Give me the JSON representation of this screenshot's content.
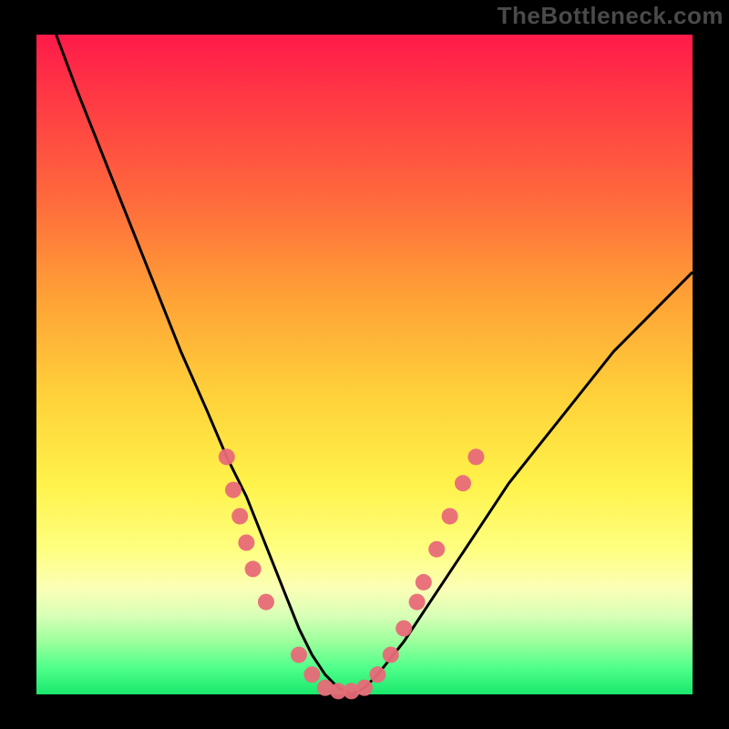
{
  "watermark": "TheBottleneck.com",
  "colors": {
    "frame_bg": "#000000",
    "dot": "#e86a78",
    "curve": "#000000"
  },
  "chart_data": {
    "type": "line",
    "title": "",
    "xlabel": "",
    "ylabel": "",
    "xlim": [
      0,
      100
    ],
    "ylim": [
      0,
      100
    ],
    "grid": false,
    "series": [
      {
        "name": "bottleneck-curve",
        "x": [
          3,
          6,
          10,
          14,
          18,
          22,
          26,
          29,
          32,
          34,
          36,
          38,
          40,
          42,
          44,
          46,
          48,
          50,
          52,
          56,
          60,
          64,
          68,
          72,
          76,
          80,
          84,
          88,
          92,
          96,
          100
        ],
        "y": [
          100,
          92,
          82,
          72,
          62,
          52,
          43,
          36,
          30,
          25,
          20,
          15,
          10,
          6,
          3,
          1,
          0,
          1,
          3,
          8,
          14,
          20,
          26,
          32,
          37,
          42,
          47,
          52,
          56,
          60,
          64
        ]
      }
    ],
    "scatter": [
      {
        "name": "left-marks",
        "points": [
          {
            "x": 29,
            "y": 36
          },
          {
            "x": 30,
            "y": 31
          },
          {
            "x": 31,
            "y": 27
          },
          {
            "x": 32,
            "y": 23
          },
          {
            "x": 33,
            "y": 19
          },
          {
            "x": 35,
            "y": 14
          }
        ]
      },
      {
        "name": "bottom-marks",
        "points": [
          {
            "x": 40,
            "y": 6
          },
          {
            "x": 42,
            "y": 3
          },
          {
            "x": 44,
            "y": 1
          },
          {
            "x": 46,
            "y": 0.5
          },
          {
            "x": 48,
            "y": 0.5
          },
          {
            "x": 50,
            "y": 1
          },
          {
            "x": 52,
            "y": 3
          },
          {
            "x": 54,
            "y": 6
          }
        ]
      },
      {
        "name": "right-marks",
        "points": [
          {
            "x": 56,
            "y": 10
          },
          {
            "x": 58,
            "y": 14
          },
          {
            "x": 59,
            "y": 17
          },
          {
            "x": 61,
            "y": 22
          },
          {
            "x": 63,
            "y": 27
          },
          {
            "x": 65,
            "y": 32
          },
          {
            "x": 67,
            "y": 36
          }
        ]
      }
    ]
  }
}
